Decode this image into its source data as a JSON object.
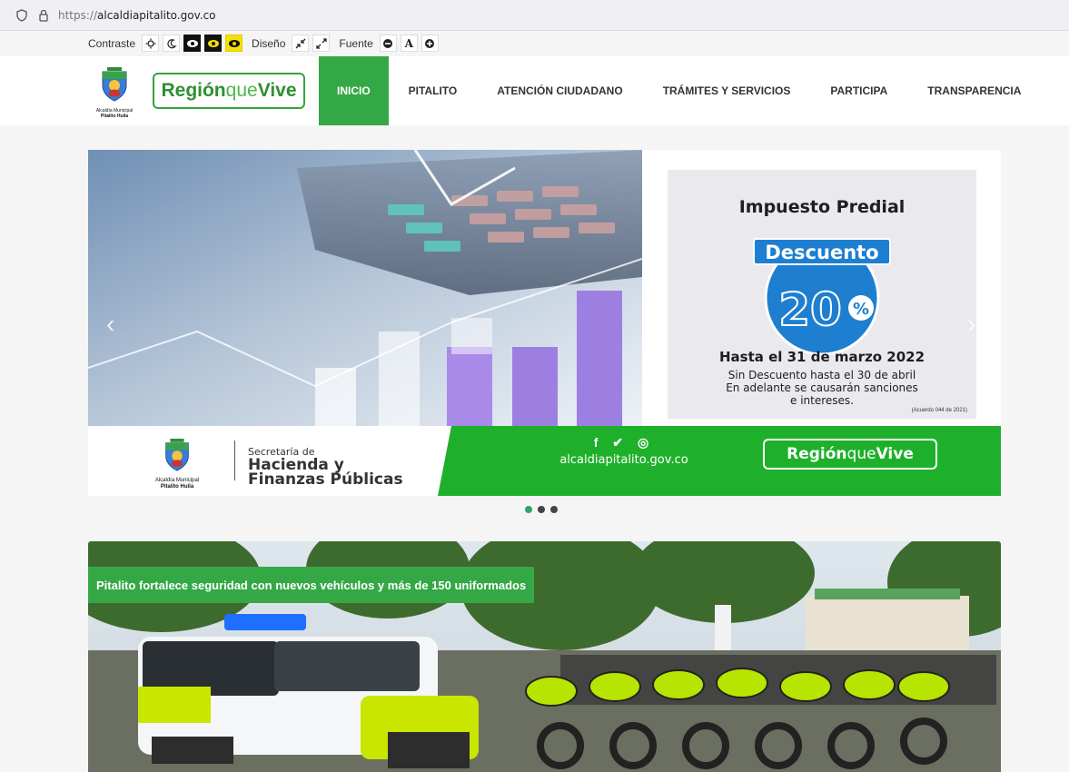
{
  "browser": {
    "url_scheme": "https://",
    "url_host": "alcaldiapitalito.gov.co",
    "icons": [
      "shield-icon",
      "lock-icon"
    ]
  },
  "accessibility": {
    "contrast_label": "Contraste",
    "design_label": "Diseño",
    "font_label": "Fuente",
    "font_letter": "A",
    "search_icon": "search-icon"
  },
  "header": {
    "shield_caption_line1": "Alcaldía Municipal",
    "shield_caption_line2": "Pitalito Huila",
    "region_logo_bold1": "Región",
    "region_logo_light": "que",
    "region_logo_bold2": "Vive"
  },
  "nav": {
    "items": [
      {
        "label": "INICIO",
        "active": true
      },
      {
        "label": "PITALITO",
        "active": false
      },
      {
        "label": "ATENCIÓN CIUDADANO",
        "active": false
      },
      {
        "label": "TRÁMITES Y SERVICIOS",
        "active": false
      },
      {
        "label": "PARTICIPA",
        "active": false
      },
      {
        "label": "TRANSPARENCIA",
        "active": false
      }
    ]
  },
  "banner": {
    "promo_title": "Impuesto Predial",
    "promo_badge": "Descuento",
    "promo_percent": "20",
    "promo_percent_sign": "%",
    "promo_deadline": "Hasta el 31 de marzo 2022",
    "promo_note_1": "Sin Descuento hasta el 30 de abril",
    "promo_note_2": "En adelante se causarán sanciones",
    "promo_note_3": "e intereses.",
    "promo_foot": "(Acuerdo 044 de 2021)",
    "foot_caption_1": "Alcaldía Municipal",
    "foot_caption_2": "Pitalito Huila",
    "sec_small": "Secretaría de",
    "sec_big_1": "Hacienda y",
    "sec_big_2": "Finanzas Públicas",
    "social_icons": "f ✔ ◎",
    "site": "alcaldiapitalito.gov.co",
    "region_bold1": "Región",
    "region_light": "que",
    "region_bold2": "Vive",
    "arrow_left": "‹",
    "arrow_right": "›"
  },
  "carousel": {
    "slides": 3,
    "active_index": 0
  },
  "news": {
    "caption": "Pitalito fortalece seguridad con nuevos vehículos y más de 150 uniformados"
  },
  "colors": {
    "brand_green": "#35a846",
    "promo_blue": "#1e7fd0",
    "active_dot": "#2ea36a"
  }
}
